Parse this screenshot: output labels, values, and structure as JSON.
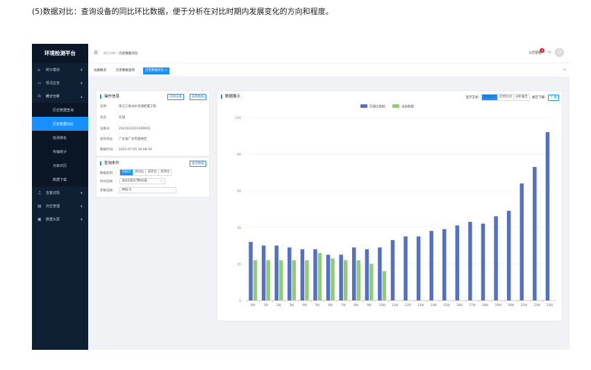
{
  "caption": "(5)数据对比：查询设备的同比环比数据，便于分析在对比时期内发展变化的方向和程度。",
  "app": {
    "title": "环境检测平台"
  },
  "sidebar": {
    "items": [
      {
        "label": "统计模块",
        "icon": "home-icon"
      },
      {
        "label": "情况总览",
        "icon": "monitor-icon"
      },
      {
        "label": "统计分析",
        "icon": "chart-icon"
      }
    ],
    "sub_items": [
      {
        "label": "历史数据查询"
      },
      {
        "label": "历史数据对比"
      },
      {
        "label": "检测排名"
      },
      {
        "label": "传输统计"
      },
      {
        "label": "污染日历"
      },
      {
        "label": "数据下载"
      }
    ],
    "items_after": [
      {
        "label": "告警详情",
        "icon": "bell-icon"
      },
      {
        "label": "日志管理",
        "icon": "doc-icon"
      },
      {
        "label": "数据大屏",
        "icon": "screen-icon"
      }
    ]
  },
  "header": {
    "breadcrumb_root": "统计分析",
    "breadcrumb_sep": "/",
    "breadcrumb_current": "历史数据对比",
    "notice_label": "公告管理",
    "notice_count": "1",
    "more_icon": "::"
  },
  "tabs": [
    {
      "label": "设备概况"
    },
    {
      "label": "历史数据查询"
    },
    {
      "label": "历史数据对比 ×"
    }
  ],
  "info_panel": {
    "title": "操作信息",
    "btn_select": "选择设备",
    "btn_view": "查看数据",
    "rows": [
      {
        "key": "名称:",
        "value": "珠江三角洲水资源配置工程"
      },
      {
        "key": "状态:",
        "value": "在线"
      },
      {
        "key": "设备号:",
        "value": "2021033103100001"
      },
      {
        "key": "安装地址:",
        "value": "广东省广州市越秀区"
      },
      {
        "key": "数据时间:",
        "value": "2021-07-05 10:08:54"
      }
    ]
  },
  "query_panel": {
    "title": "查询条件",
    "btn_query": "查询数据",
    "type_key": "数据类别:",
    "type_options": [
      "日同比",
      "月同比",
      "日环比",
      "月环比"
    ],
    "type_selected": 0,
    "time_key": "时间选择:",
    "time_value": "2021年07月05日",
    "param_key": "参数选择:",
    "param_value": "PM2.5"
  },
  "display_panel": {
    "title": "数据展示",
    "mode_label": "显示方式:",
    "modes": [
      "数值比对",
      "走势比对",
      "分析报告"
    ],
    "mode_selected": 0,
    "report_label": "报告下载:",
    "download": "下 载"
  },
  "chart_data": {
    "type": "bar",
    "categories": [
      "0时",
      "1时",
      "2时",
      "3时",
      "4时",
      "5时",
      "6时",
      "7时",
      "8时",
      "9时",
      "10时",
      "11时",
      "12时",
      "13时",
      "14时",
      "15时",
      "16时",
      "17时",
      "18时",
      "19时",
      "20时",
      "21时",
      "22时",
      "23时"
    ],
    "series": [
      {
        "name": "日期比数据",
        "color": "#5470c6",
        "values": [
          32,
          30,
          30,
          29,
          28,
          28,
          25,
          25,
          29,
          28,
          29,
          33,
          35,
          35,
          38,
          39,
          41,
          43,
          42,
          46,
          49,
          64,
          73,
          92
        ]
      },
      {
        "name": "当前数据",
        "color": "#91cc75",
        "values": [
          22,
          22,
          22,
          22,
          22,
          26,
          23,
          22,
          22,
          20,
          16,
          null,
          null,
          null,
          null,
          null,
          null,
          null,
          null,
          null,
          null,
          null,
          null,
          null
        ]
      }
    ],
    "yticks": [
      0,
      20,
      40,
      60,
      80,
      100
    ],
    "ylim": [
      0,
      100
    ]
  }
}
